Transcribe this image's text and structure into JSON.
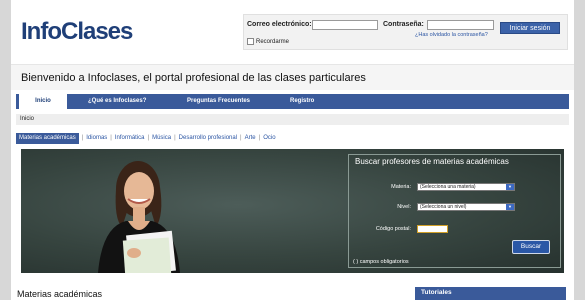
{
  "brand": {
    "logo_part1": "Info",
    "logo_part2": "Clases"
  },
  "login": {
    "email_label": "Correo electrónico:",
    "email_value": "",
    "password_label": "Contraseña:",
    "password_value": "",
    "submit_label": "Iniciar sesión",
    "forgot_label": "¿Has olvidado la contraseña?",
    "remember_label": "Recordarme"
  },
  "welcome": {
    "text": "Bienvenido a Infoclases, el portal profesional de las clases particulares"
  },
  "nav": {
    "items": [
      {
        "label": "Inicio",
        "active": true
      },
      {
        "label": "¿Qué es Infoclases?",
        "active": false
      },
      {
        "label": "Preguntas Frecuentes",
        "active": false
      },
      {
        "label": "Registro",
        "active": false
      }
    ]
  },
  "breadcrumb": {
    "current": "Inicio"
  },
  "categories": {
    "items": [
      "Materias académicas",
      "Idiomas",
      "Informática",
      "Música",
      "Desarrollo profesional",
      "Arte",
      "Ocio"
    ],
    "selected": "Materias académicas"
  },
  "search": {
    "title": "Buscar profesores de materias académicas",
    "subject_label": "Materia:",
    "subject_value": "(Selecciona una materia)",
    "level_label": "Nivel:",
    "level_value": "(Selecciona un nivel)",
    "postal_label": "Código postal:",
    "postal_value": "",
    "button_label": "Buscar",
    "required_note": "( ) campos obligatorios"
  },
  "main": {
    "title": "Materias académicas"
  },
  "sidebar": {
    "title": "Tutoriales"
  },
  "colors": {
    "brand_blue": "#3a5a9a",
    "logo_blue": "#1f3f78",
    "chalkboard": "#36443f"
  }
}
